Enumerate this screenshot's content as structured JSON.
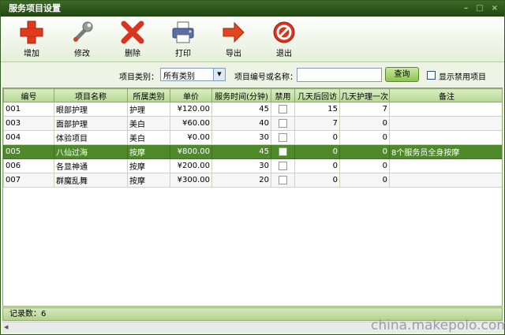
{
  "window": {
    "title": "服务项目设置",
    "controls": [
      "–",
      "□",
      "×"
    ]
  },
  "toolbar": [
    {
      "label": "增加",
      "icon": "add-icon",
      "color": "#e03a1e"
    },
    {
      "label": "修改",
      "icon": "wrench-icon",
      "color": "#8a8a8a"
    },
    {
      "label": "删除",
      "icon": "delete-icon",
      "color": "#d9341f"
    },
    {
      "label": "打印",
      "icon": "printer-icon",
      "color": "#5a6fa8"
    },
    {
      "label": "导出",
      "icon": "export-arrow-icon",
      "color": "#e0471e"
    },
    {
      "label": "退出",
      "icon": "exit-icon",
      "color": "#d9341f"
    }
  ],
  "filter": {
    "category_label": "项目类别：",
    "category_value": "所有类别",
    "name_label": "项目编号或名称：",
    "name_value": "",
    "search_label": "查询",
    "show_disabled_label": "显示禁用项目"
  },
  "table": {
    "columns": [
      "编号",
      "项目名称",
      "所属类别",
      "单价",
      "服务时间(分钟)",
      "禁用",
      "几天后回访",
      "几天护理一次",
      "备注"
    ],
    "rows": [
      [
        "001",
        "眼部护理",
        "护理",
        "¥120.00",
        "45",
        "",
        "15",
        "7",
        ""
      ],
      [
        "003",
        "面部护理",
        "美白",
        "¥60.00",
        "40",
        "",
        "7",
        "0",
        ""
      ],
      [
        "004",
        "体验项目",
        "美白",
        "¥0.00",
        "30",
        "",
        "0",
        "0",
        ""
      ],
      [
        "005",
        "八仙过海",
        "按摩",
        "¥800.00",
        "45",
        "",
        "0",
        "0",
        "8个服务员全身按摩"
      ],
      [
        "006",
        "各显神通",
        "按摩",
        "¥200.00",
        "30",
        "",
        "0",
        "0",
        ""
      ],
      [
        "007",
        "群魔乱舞",
        "按摩",
        "¥300.00",
        "20",
        "",
        "0",
        "0",
        ""
      ]
    ],
    "selected_row": 3
  },
  "status": {
    "record_count": "记录数：6"
  },
  "watermark": "china.makepolo.com"
}
